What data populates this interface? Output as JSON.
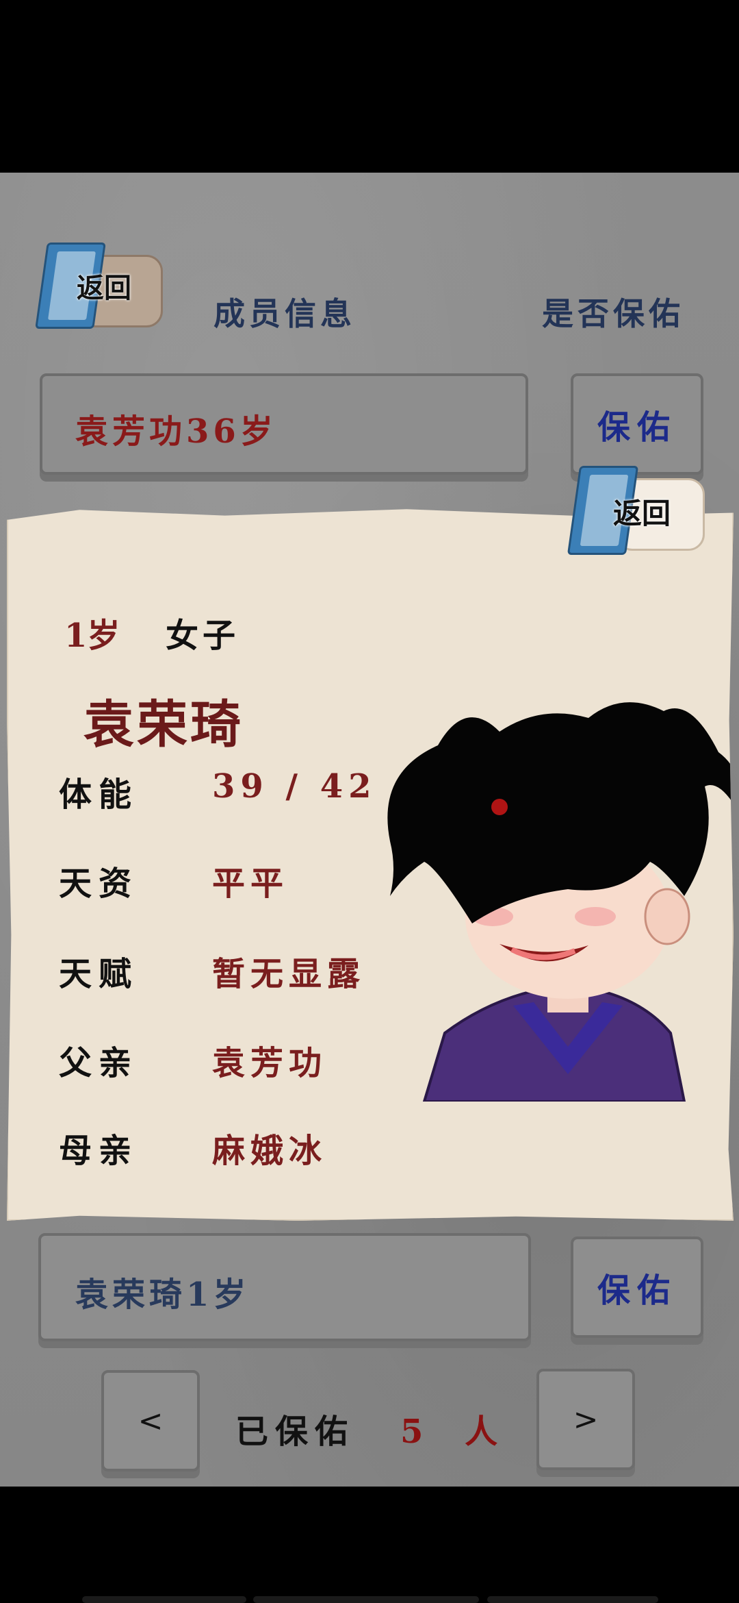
{
  "header": {
    "back_label": "返回",
    "member_info_title": "成员信息",
    "protect_question": "是否保佑"
  },
  "members": [
    {
      "name_age": "袁芳功36岁",
      "action": "保佑"
    },
    {
      "name_age": "袁荣琦1岁",
      "action": "保佑"
    }
  ],
  "detail_card": {
    "back_label": "返回",
    "age": "1岁",
    "gender": "女子",
    "name": "袁荣琦",
    "fields": [
      {
        "label": "体能",
        "value": "39 / 42"
      },
      {
        "label": "天资",
        "value": "平平"
      },
      {
        "label": "天赋",
        "value": "暂无显露"
      },
      {
        "label": "父亲",
        "value": "袁芳功"
      },
      {
        "label": "母亲",
        "value": "麻娥冰"
      }
    ]
  },
  "footer": {
    "prev_label": "<",
    "next_label": ">",
    "protected_label": "已保佑",
    "protected_count": "5 人"
  },
  "colors": {
    "accent_red": "#7a1e1e",
    "header_blue": "#233457",
    "button_blue": "#1c2a8a",
    "paper": "#ede3d3"
  }
}
